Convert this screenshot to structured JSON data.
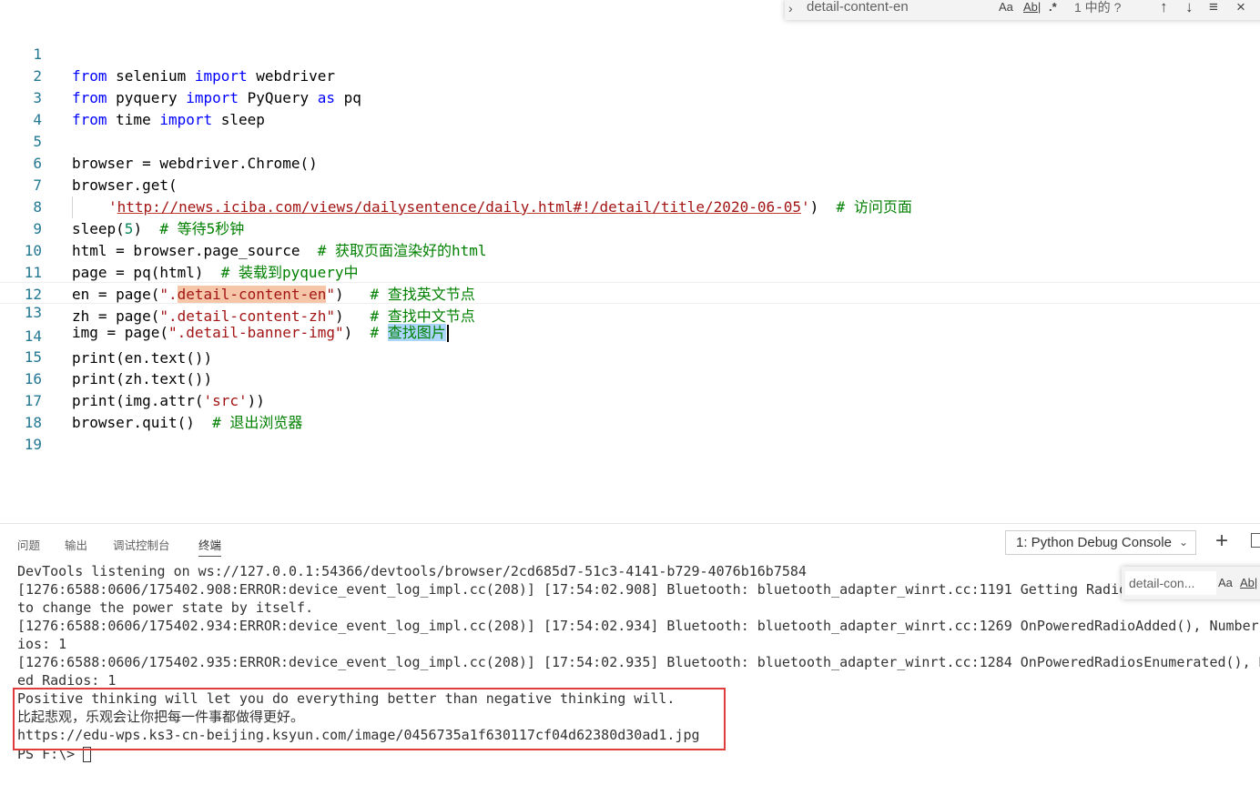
{
  "editor": {
    "find": {
      "query": "detail-content-en",
      "match_case": "Aa",
      "whole_word": "Ab|",
      "regex": ".*",
      "result": "1 中的 ?",
      "prev": "↑",
      "next": "↓",
      "selection": "≡",
      "close": "×",
      "toggle": "›"
    },
    "lines": [
      {
        "n": "1"
      },
      {
        "n": "2"
      },
      {
        "n": "3"
      },
      {
        "n": "4"
      },
      {
        "n": "5"
      },
      {
        "n": "6"
      },
      {
        "n": "7"
      },
      {
        "n": "8"
      },
      {
        "n": "9"
      },
      {
        "n": "10"
      },
      {
        "n": "11"
      },
      {
        "n": "12"
      },
      {
        "n": "13"
      },
      {
        "n": "14"
      },
      {
        "n": "15"
      },
      {
        "n": "16"
      },
      {
        "n": "17"
      },
      {
        "n": "18"
      },
      {
        "n": "19"
      }
    ],
    "code": {
      "l1": {
        "a": "from",
        "b": " selenium ",
        "c": "import",
        "d": " webdriver"
      },
      "l2": {
        "a": "from",
        "b": " pyquery ",
        "c": "import",
        "d": " PyQuery ",
        "e": "as",
        "f": " pq"
      },
      "l3": {
        "a": "from",
        "b": " time ",
        "c": "import",
        "d": " sleep"
      },
      "l5": {
        "a": "browser = webdriver.Chrome()"
      },
      "l6": {
        "a": "browser.get("
      },
      "l7": {
        "q1": "'",
        "url": "http://news.iciba.com/views/dailysentence/daily.html#!/detail/title/2020-06-05",
        "q2": "'",
        "rest": ")  ",
        "cm": "# 访问页面"
      },
      "l8": {
        "a": "sleep(",
        "num": "5",
        "b": ")  ",
        "cm": "# 等待5秒钟"
      },
      "l9": {
        "a": "html = browser.page_source  ",
        "cm": "# 获取页面渲染好的html"
      },
      "l10": {
        "a": "page = pq(html)  ",
        "cm": "# 装载到pyquery中"
      },
      "l11": {
        "a": "en = page(",
        "s1": "\".",
        "hl": "detail-content-en",
        "s2": "\"",
        "b": ")   ",
        "cm": "# 查找英文节点"
      },
      "l12": {
        "a": "zh = page(",
        "s": "\".detail-content-zh\"",
        "b": ")   ",
        "cm": "# 查找中文节点"
      },
      "l13": {
        "a": "img = page(",
        "s": "\".detail-banner-img\"",
        "b": ")  ",
        "cm1": "# ",
        "sel": "查找图片"
      },
      "l14": {
        "a": "print(en.text())"
      },
      "l15": {
        "a": "print(zh.text())"
      },
      "l16": {
        "a": "print(img.attr(",
        "s": "'src'",
        "b": "))"
      },
      "l17": {
        "a": "browser.quit()  ",
        "cm": "# 退出浏览器"
      }
    }
  },
  "panel": {
    "tabs": [
      "问题",
      "输出",
      "调试控制台",
      "终端"
    ],
    "active_tab": "终端",
    "terminal_select": "1: Python Debug Console",
    "add_label": "+",
    "term_find": {
      "query": "detail-con...",
      "match_case": "Aa",
      "whole_word": "Ab|"
    },
    "terminal_lines": [
      "DevTools listening on ws://127.0.0.1:54366/devtools/browser/2cd685d7-51c3-4141-b729-4076b16b7584",
      "[1276:6588:0606/175402.908:ERROR:device_event_log_impl.cc(208)] [17:54:02.908] Bluetooth: bluetooth_adapter_winrt.cc:1191 Getting Radio",
      "to change the power state by itself.",
      "[1276:6588:0606/175402.934:ERROR:device_event_log_impl.cc(208)] [17:54:02.934] Bluetooth: bluetooth_adapter_winrt.cc:1269 OnPoweredRadioAdded(), Number",
      "ios: 1",
      "[1276:6588:0606/175402.935:ERROR:device_event_log_impl.cc(208)] [17:54:02.935] Bluetooth: bluetooth_adapter_winrt.cc:1284 OnPoweredRadiosEnumerated(), N",
      "ed Radios: 1",
      "Positive thinking will let you do everything better than negative thinking will.",
      "比起悲观，乐观会让你把每一件事都做得更好。",
      "https://edu-wps.ks3-cn-beijing.ksyun.com/image/0456735a1f630117cf04d62380d30ad1.jpg",
      "PS F:\\> "
    ]
  }
}
